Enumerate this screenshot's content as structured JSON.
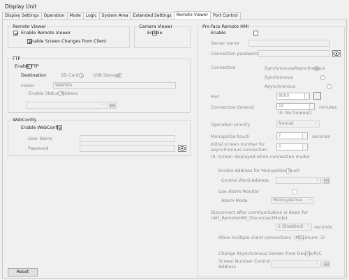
{
  "window": {
    "title": "Display Unit"
  },
  "tabs": [
    {
      "label": "Display Settings"
    },
    {
      "label": "Operation"
    },
    {
      "label": "Mode"
    },
    {
      "label": "Logic"
    },
    {
      "label": "System Area"
    },
    {
      "label": "Extended Settings"
    },
    {
      "label": "Remote Viewer",
      "active": true
    },
    {
      "label": "Port Control"
    }
  ],
  "remote_viewer": {
    "title": "Remote Viewer",
    "enable_label": "Enable Remote Viewer",
    "enable_checked": true,
    "screen_changes_label": "Enable Screen Changes from Client",
    "screen_changes_checked": true
  },
  "camera_viewer": {
    "title": "Camera Viewer",
    "enable_label": "Enable",
    "enable_checked": false
  },
  "ftp": {
    "title": "FTP",
    "enable_label": "Enable FTP",
    "enable_checked": false,
    "destination_label": "Destination",
    "sd_label": "SD Card",
    "usb_label": "USB Storage",
    "selected": "SD Card",
    "folder_label": "Folder",
    "folder_value": "WebSite",
    "status_label": "Enable Status Address",
    "status_checked": false
  },
  "webconfig": {
    "title": "WebConfig",
    "enable_label": "Enable WebConfig",
    "enable_checked": false,
    "username_label": "User Name",
    "password_label": "Password"
  },
  "hmi": {
    "title": "Pro-face Remote HMI",
    "enable_label": "Enable",
    "enable_checked": false,
    "server_label": "Server name",
    "conn_pw_label": "Connection password",
    "connection_label": "Connection",
    "conn_options": [
      "Synchronous/Asynchronous",
      "Synchronous",
      "Asynchronous"
    ],
    "conn_selected": "Synchronous/Asynchronous",
    "port_label": "Port",
    "port_value": "8000",
    "timeout_label": "Connection timeout",
    "timeout_value": "10",
    "timeout_unit": "minutes",
    "timeout_note": "(0: No timeout)",
    "priority_label": "Operation priority",
    "priority_value": "Normal",
    "monopolize_label": "Monopolize touch",
    "monopolize_value": "2",
    "monopolize_unit": "seconds",
    "initial_label_1": "Initial screen number for",
    "initial_label_2": "asynchronous connection",
    "initial_value": "0",
    "initial_note": "(0: screen displayed when connection made)",
    "enable_address_label": "Enable Address for Monopolize Touch",
    "enable_address_checked": false,
    "control_word_label": "Control Word Address",
    "alarm_monitor_label": "Use Alarm Monitor",
    "alarm_monitor_checked": false,
    "alarm_mode_label": "Alarm Mode",
    "alarm_mode_value": "History/Active",
    "disconnect_label_1": "Disconnect after communication is down for",
    "disconnect_label_2": "(#H_RemoteHMI_DisconnectMode)",
    "disconnect_value": "0 (Disabled)",
    "disconnect_unit": "seconds",
    "multi_label": "Allow multiple client connections",
    "multi_max": "(Maximum: 3)",
    "multi_checked": false,
    "change_async_label": "Change Asynchronous Screen from Device/PLC",
    "change_async_checked": false,
    "screen_ctrl_label_1": "Screen Number Control",
    "screen_ctrl_label_2": "Address"
  },
  "footer": {
    "reset_label": "Reset"
  },
  "icons": {
    "eye": "eye-icon",
    "address": "address-picker-icon",
    "check": "checkmark-icon",
    "dropdown": "chevron-down-icon"
  }
}
